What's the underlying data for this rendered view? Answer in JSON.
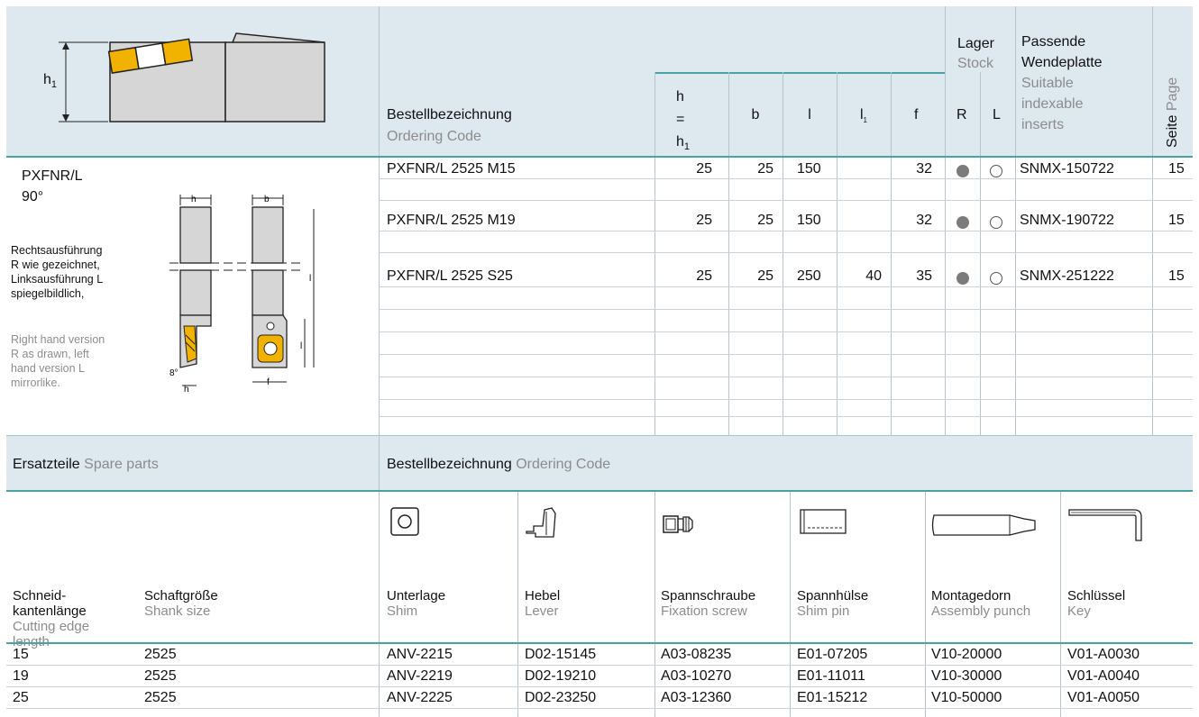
{
  "header": {
    "h1_label": "h",
    "h1_sub": "1",
    "ordering_de": "Bestellbezeichnung",
    "ordering_en": "Ordering Code",
    "col_h": [
      "h",
      "=",
      "h"
    ],
    "col_h_sub": "1",
    "col_b": "b",
    "col_l": "l",
    "col_l1": "l",
    "col_l1_sub": "1",
    "col_f": "f",
    "lager_de": "Lager",
    "lager_en": "Stock",
    "col_R": "R",
    "col_L": "L",
    "insert_de_1": "Passende",
    "insert_de_2": "Wendeplatte",
    "insert_en_1": "Suitable",
    "insert_en_2": "indexable",
    "insert_en_3": "inserts",
    "seite_de": "Seite",
    "seite_en": "Page"
  },
  "product": {
    "name": "PXFNR/L",
    "angle": "90°",
    "desc_de": [
      "Rechtsausführung",
      "R wie gezeichnet,",
      "Linksausführung L",
      "spiegelbildlich,"
    ],
    "desc_en": [
      "Right hand version",
      "R as drawn, left",
      "hand version L",
      "mirrorlike."
    ],
    "drawing_labels": {
      "h": "h",
      "b": "b",
      "l": "l",
      "l1": "l",
      "angle8": "8°",
      "f": "f",
      "h1": "h"
    }
  },
  "rows": [
    {
      "code": "PXFNR/L 2525 M15",
      "h": "25",
      "b": "25",
      "l": "150",
      "l1": "",
      "f": "32",
      "stock_R": "filled",
      "stock_L": "open",
      "insert": "SNMX-150722",
      "page": "15"
    },
    {
      "code": "PXFNR/L 2525 M19",
      "h": "25",
      "b": "25",
      "l": "150",
      "l1": "",
      "f": "32",
      "stock_R": "filled",
      "stock_L": "open",
      "insert": "SNMX-190722",
      "page": "15"
    },
    {
      "code": "PXFNR/L 2525 S25",
      "h": "25",
      "b": "25",
      "l": "250",
      "l1": "40",
      "f": "35",
      "stock_R": "filled",
      "stock_L": "open",
      "insert": "SNMX-251222",
      "page": "15"
    }
  ],
  "spare": {
    "title_de": "Ersatzteile",
    "title_en": "Spare parts",
    "ordering_de": "Bestellbezeichnung",
    "ordering_en": "Ordering Code",
    "col_edge_de": [
      "Schneid-",
      "kantenlänge"
    ],
    "col_edge_en": [
      "Cutting edge",
      "length"
    ],
    "col_shank_de": "Schaftgröße",
    "col_shank_en": "Shank size",
    "parts": [
      {
        "de": "Unterlage",
        "en": "Shim",
        "icon": "shim-icon"
      },
      {
        "de": "Hebel",
        "en": "Lever",
        "icon": "lever-icon"
      },
      {
        "de": "Spannschraube",
        "en": "Fixation screw",
        "icon": "screw-icon"
      },
      {
        "de": "Spannhülse",
        "en": "Shim pin",
        "icon": "shim-pin-icon"
      },
      {
        "de": "Montagedorn",
        "en": "Assembly punch",
        "icon": "punch-icon"
      },
      {
        "de": "Schlüssel",
        "en": "Key",
        "icon": "key-icon"
      }
    ],
    "rows": [
      {
        "edge": "15",
        "shank": "2525",
        "cells": [
          "ANV-2215",
          "D02-15145",
          "A03-08235",
          "E01-07205",
          "V10-20000",
          "V01-A0030"
        ]
      },
      {
        "edge": "19",
        "shank": "2525",
        "cells": [
          "ANV-2219",
          "D02-19210",
          "A03-10270",
          "E01-11011",
          "V10-30000",
          "V01-A0040"
        ]
      },
      {
        "edge": "25",
        "shank": "2525",
        "cells": [
          "ANV-2225",
          "D02-23250",
          "A03-12360",
          "E01-15212",
          "V10-50000",
          "V01-A0050"
        ]
      }
    ]
  }
}
